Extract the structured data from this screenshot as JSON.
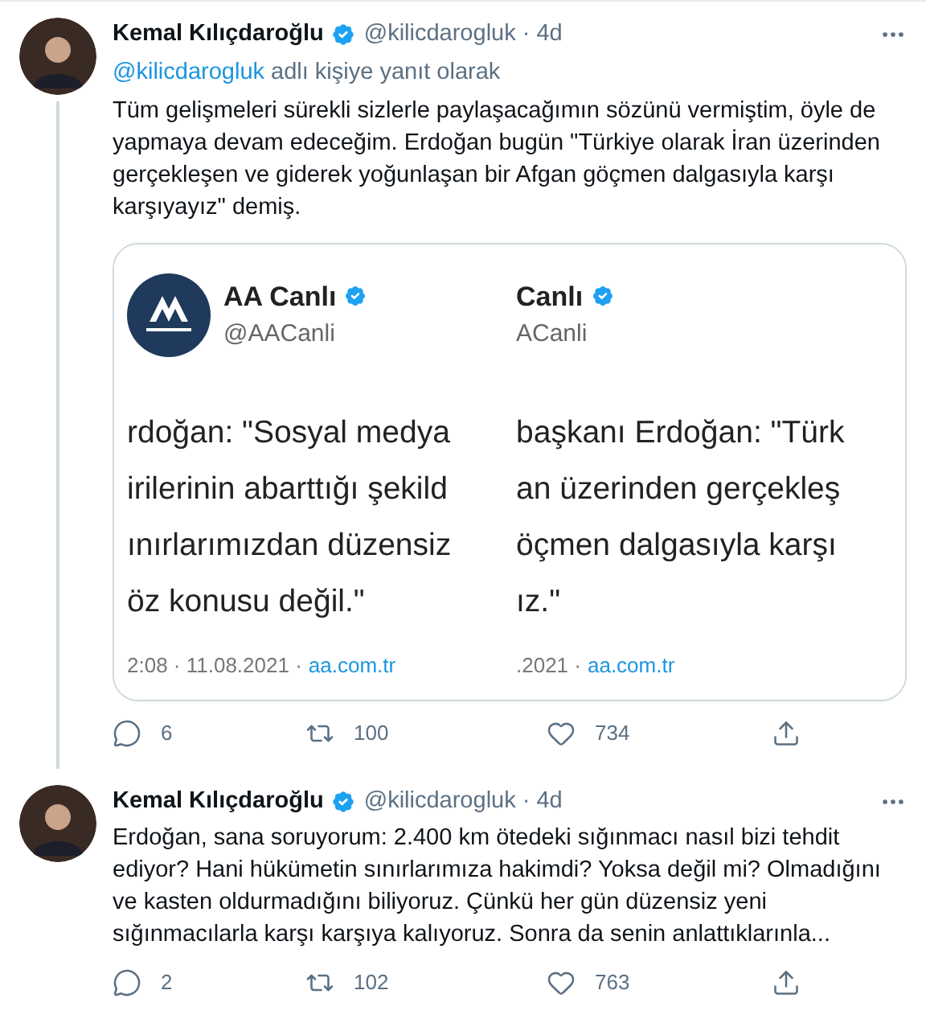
{
  "tweets": [
    {
      "name": "Kemal Kılıçdaroğlu",
      "verified": true,
      "handle": "@kilicdarogluk",
      "dot": "·",
      "time": "4d",
      "thread_below": true,
      "reply_to": {
        "handle": "@kilicdarogluk",
        "text": "adlı kişiye yanıt olarak"
      },
      "text": "Tüm gelişmeleri sürekli sizlerle paylaşacağımın sözünü vermiştim, öyle de yapmaya devam edeceğim. Erdoğan bugün \"Türkiye olarak İran üzerinden gerçekleşen ve giderek yoğunlaşan bir Afgan göçmen dalgasıyla karşı karşıyayız\" demiş.",
      "attachment": {
        "panels": [
          {
            "avatar": true,
            "account_name": "AA Canlı",
            "account_handle": "@AACanli",
            "lines": [
              "rdoğan: \"Sosyal medya",
              "irilerinin abarttığı şekild",
              "ınırlarımızdan düzensiz",
              "öz konusu değil.\""
            ],
            "meta": "2:08 · 11.08.2021 ·",
            "link": "aa.com.tr"
          },
          {
            "avatar": false,
            "account_name": "Canlı",
            "account_handle": "ACanli",
            "lines": [
              "başkanı Erdoğan: \"Türk",
              "an üzerinden gerçekleş",
              "öçmen dalgasıyla karşı",
              "ız.\""
            ],
            "meta": ".2021 ·",
            "link": "aa.com.tr"
          }
        ]
      },
      "actions": [
        {
          "kind": "reply",
          "count": "6"
        },
        {
          "kind": "retweet",
          "count": "100"
        },
        {
          "kind": "like",
          "count": "734"
        },
        {
          "kind": "share"
        }
      ]
    },
    {
      "name": "Kemal Kılıçdaroğlu",
      "verified": true,
      "handle": "@kilicdarogluk",
      "dot": "·",
      "time": "4d",
      "thread_below": false,
      "text": "Erdoğan, sana soruyorum: 2.400 km ötedeki sığınmacı nasıl bizi tehdit ediyor? Hani hükümetin sınırlarımıza hakimdi? Yoksa değil mi? Olmadığını ve kasten oldurmadığını biliyoruz. Çünkü her gün düzensiz yeni sığınmacılarla karşı karşıya kalıyoruz. Sonra da senin anlattıklarınla...",
      "actions": [
        {
          "kind": "reply",
          "count": "2"
        },
        {
          "kind": "retweet",
          "count": "102"
        },
        {
          "kind": "like",
          "count": "763"
        },
        {
          "kind": "share"
        }
      ]
    }
  ]
}
